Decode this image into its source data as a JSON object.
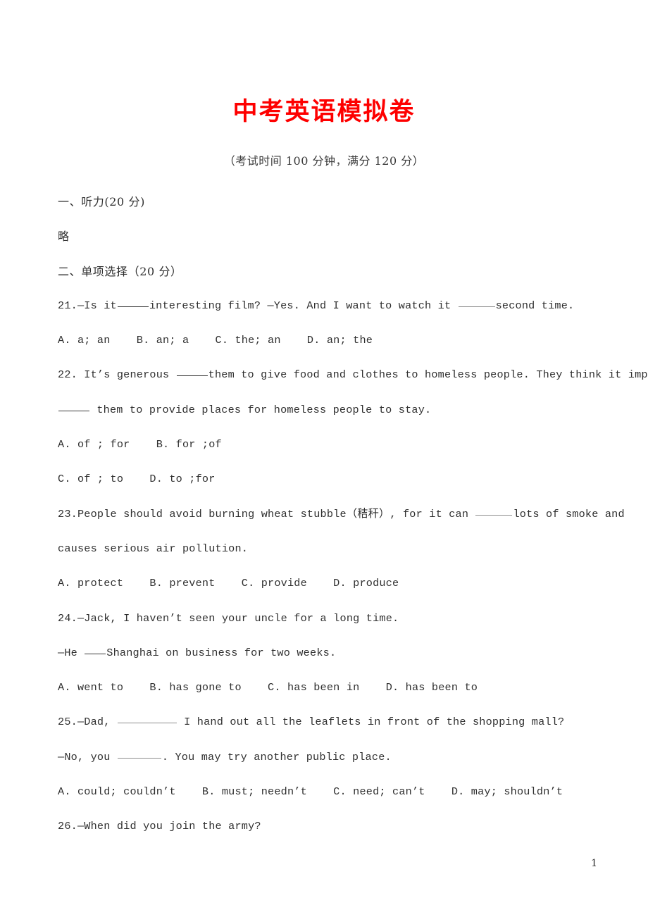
{
  "document": {
    "title": "中考英语模拟卷",
    "subtitle": "（考试时间 100 分钟，满分 120 分）",
    "title_color": "#fe0000",
    "text_color": "#2f2f2f",
    "page_number": "1"
  },
  "sections": {
    "listening_heading": "一、听力(20 分)",
    "listening_body": "略",
    "choice_heading": "二、单项选择（20 分）"
  },
  "questions": [
    {
      "id": "q21",
      "stem_a": "21.—Is it",
      "stem_b": "interesting film? —Yes. And I want to watch it ",
      "stem_c": "second time.",
      "options_line": "A. a; an    B. an; a    C. the; an    D. an; the"
    },
    {
      "id": "q22",
      "stem_a": "22. It’s generous ",
      "stem_b": "them to give food and clothes to homeless people. They think it important",
      "stem_c": " them to provide places for homeless people to stay.",
      "options_line_1": "A. of ; for    B. for ;of",
      "options_line_2": "C. of ; to    D. to ;for"
    },
    {
      "id": "q23",
      "stem_a": "23.People should avoid burning wheat stubble（秸秆）, for it can ",
      "stem_b": "lots of smoke and",
      "stem_c": "causes serious air pollution.",
      "options_line": "A. protect    B. prevent    C. provide    D. produce"
    },
    {
      "id": "q24",
      "stem_a": "24.—Jack, I haven’t seen your uncle for a long time.",
      "stem_b": "—He ",
      "stem_c": "Shanghai on business for two weeks.",
      "options_line": "A. went to    B. has gone to    C. has been in    D. has been to"
    },
    {
      "id": "q25",
      "stem_a": "25.—Dad, ",
      "stem_b": " I hand out all the leaflets in front of the shopping mall?",
      "stem_c": "—No, you ",
      "stem_d": ". You may try another public place.",
      "options_line": "A. could; couldn’t    B. must; needn’t    C. need; can’t    D. may; shouldn’t"
    },
    {
      "id": "q26",
      "stem_a": "26.—When did you join the army?"
    }
  ]
}
